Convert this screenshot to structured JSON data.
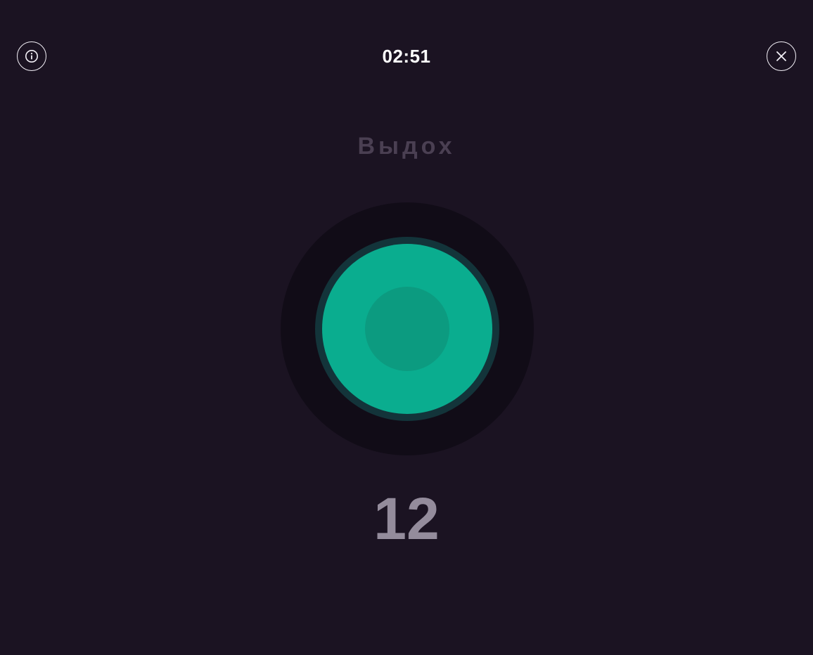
{
  "header": {
    "timer": "02:51",
    "info_icon": "info-icon",
    "close_icon": "close-icon"
  },
  "breathing": {
    "phase_label": "Выдох",
    "count": "12"
  },
  "colors": {
    "background": "#1b1322",
    "circle_accent": "#0aad8f",
    "circle_inner": "#0c9b80",
    "phase_text": "#4a3f52",
    "count_text": "#948c9c"
  }
}
